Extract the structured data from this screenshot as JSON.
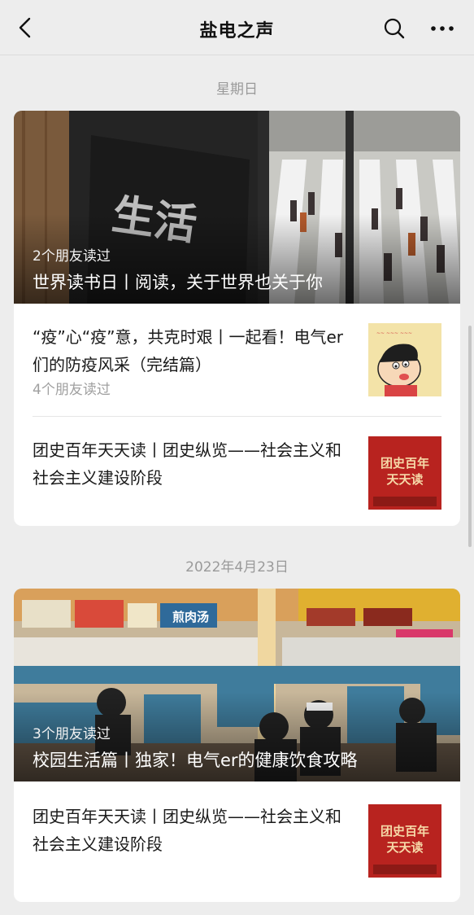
{
  "nav": {
    "title": "盐电之声",
    "back_icon": "chevron-left-icon",
    "search_icon": "search-icon",
    "more_icon": "more-dots-icon"
  },
  "groups": [
    {
      "date": "星期日",
      "hero": {
        "readers": "2个朋友读过",
        "title": "世界读书日丨阅读，关于世界也关于你",
        "sign_text": "生活"
      },
      "items": [
        {
          "title": "“疫”心“疫”意，共克时艰丨一起看！电气er们的防疫风采（完结篇）",
          "readers": "4个朋友读过",
          "thumb_icon": "cartoon-character-thumbnail"
        },
        {
          "title": "团史百年天天读丨团史纵览——社会主义和社会主义建设阶段",
          "thumb_text": [
            "团史百年",
            "天天读"
          ]
        }
      ]
    },
    {
      "date": "2022年4月23日",
      "hero": {
        "readers": "3个朋友读过",
        "title": "校园生活篇丨独家！电气er的健康饮食攻略",
        "sign_text": "煎肉汤"
      },
      "items": [
        {
          "title": "团史百年天天读丨团史纵览——社会主义和社会主义建设阶段",
          "thumb_text": [
            "团史百年",
            "天天读"
          ]
        }
      ]
    }
  ],
  "colors": {
    "page_bg": "#ededed",
    "card_bg": "#ffffff",
    "thumb_red": "#b8231f",
    "thumb_text": "#f6d9a8"
  }
}
